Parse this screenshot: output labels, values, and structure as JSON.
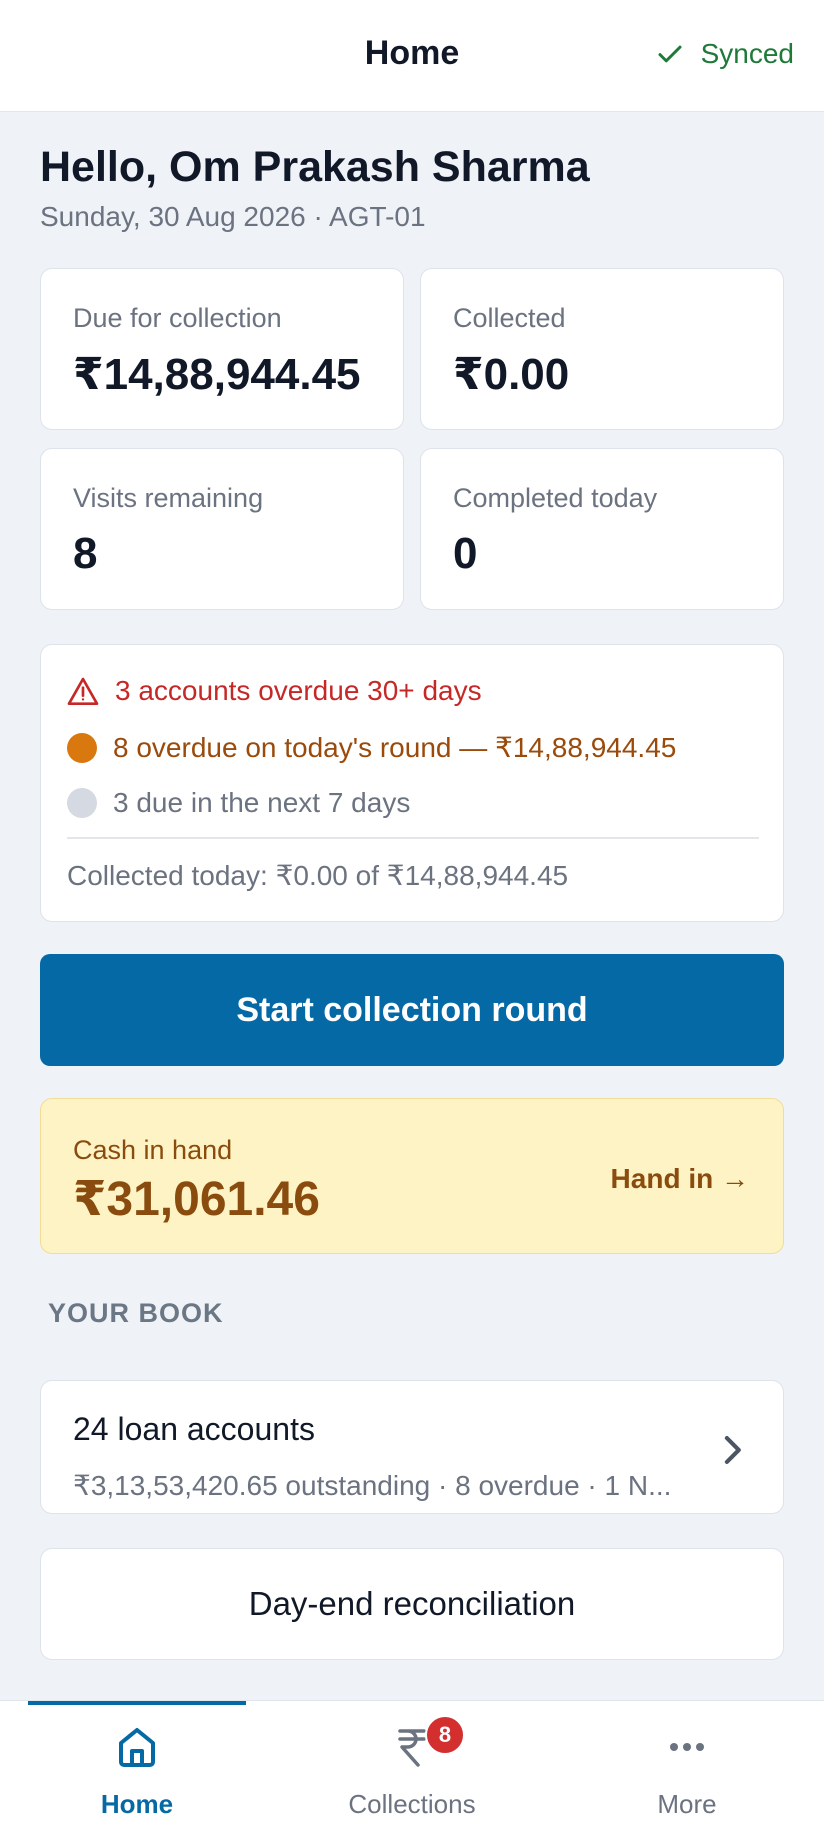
{
  "header": {
    "title": "Home",
    "sync_status": "Synced"
  },
  "greeting": {
    "hello": "Hello, Om Prakash Sharma",
    "subline": "Sunday, 30 Aug 2026 · AGT-01"
  },
  "stats": [
    {
      "label": "Due for collection",
      "value": "₹14,88,944.45"
    },
    {
      "label": "Collected",
      "value": "₹0.00"
    },
    {
      "label": "Visits remaining",
      "value": "8"
    },
    {
      "label": "Completed today",
      "value": "0"
    }
  ],
  "alerts": {
    "overdue_30": "3 accounts overdue 30+ days",
    "overdue_today": "8 overdue on today's round — ₹14,88,944.45",
    "due_next": "3 due in the next 7 days",
    "collected_summary": "Collected today: ₹0.00 of ₹14,88,944.45"
  },
  "actions": {
    "start_round": "Start collection round"
  },
  "cash": {
    "label": "Cash in hand",
    "value": "₹31,061.46",
    "hand_in": "Hand in →"
  },
  "book": {
    "section_title": "YOUR BOOK",
    "accounts": "24 loan accounts",
    "summary": "₹3,13,53,420.65 outstanding · 8 overdue · 1 N..."
  },
  "reconciliation": {
    "label": "Day-end reconciliation"
  },
  "nav": {
    "home": "Home",
    "collections": "Collections",
    "collections_badge": "8",
    "more": "More"
  },
  "colors": {
    "primary": "#0569a5",
    "alert_red": "#c62828",
    "alert_orange": "#d9780f",
    "cash_bg": "#fdf3c4",
    "synced_green": "#1f7a3a"
  }
}
